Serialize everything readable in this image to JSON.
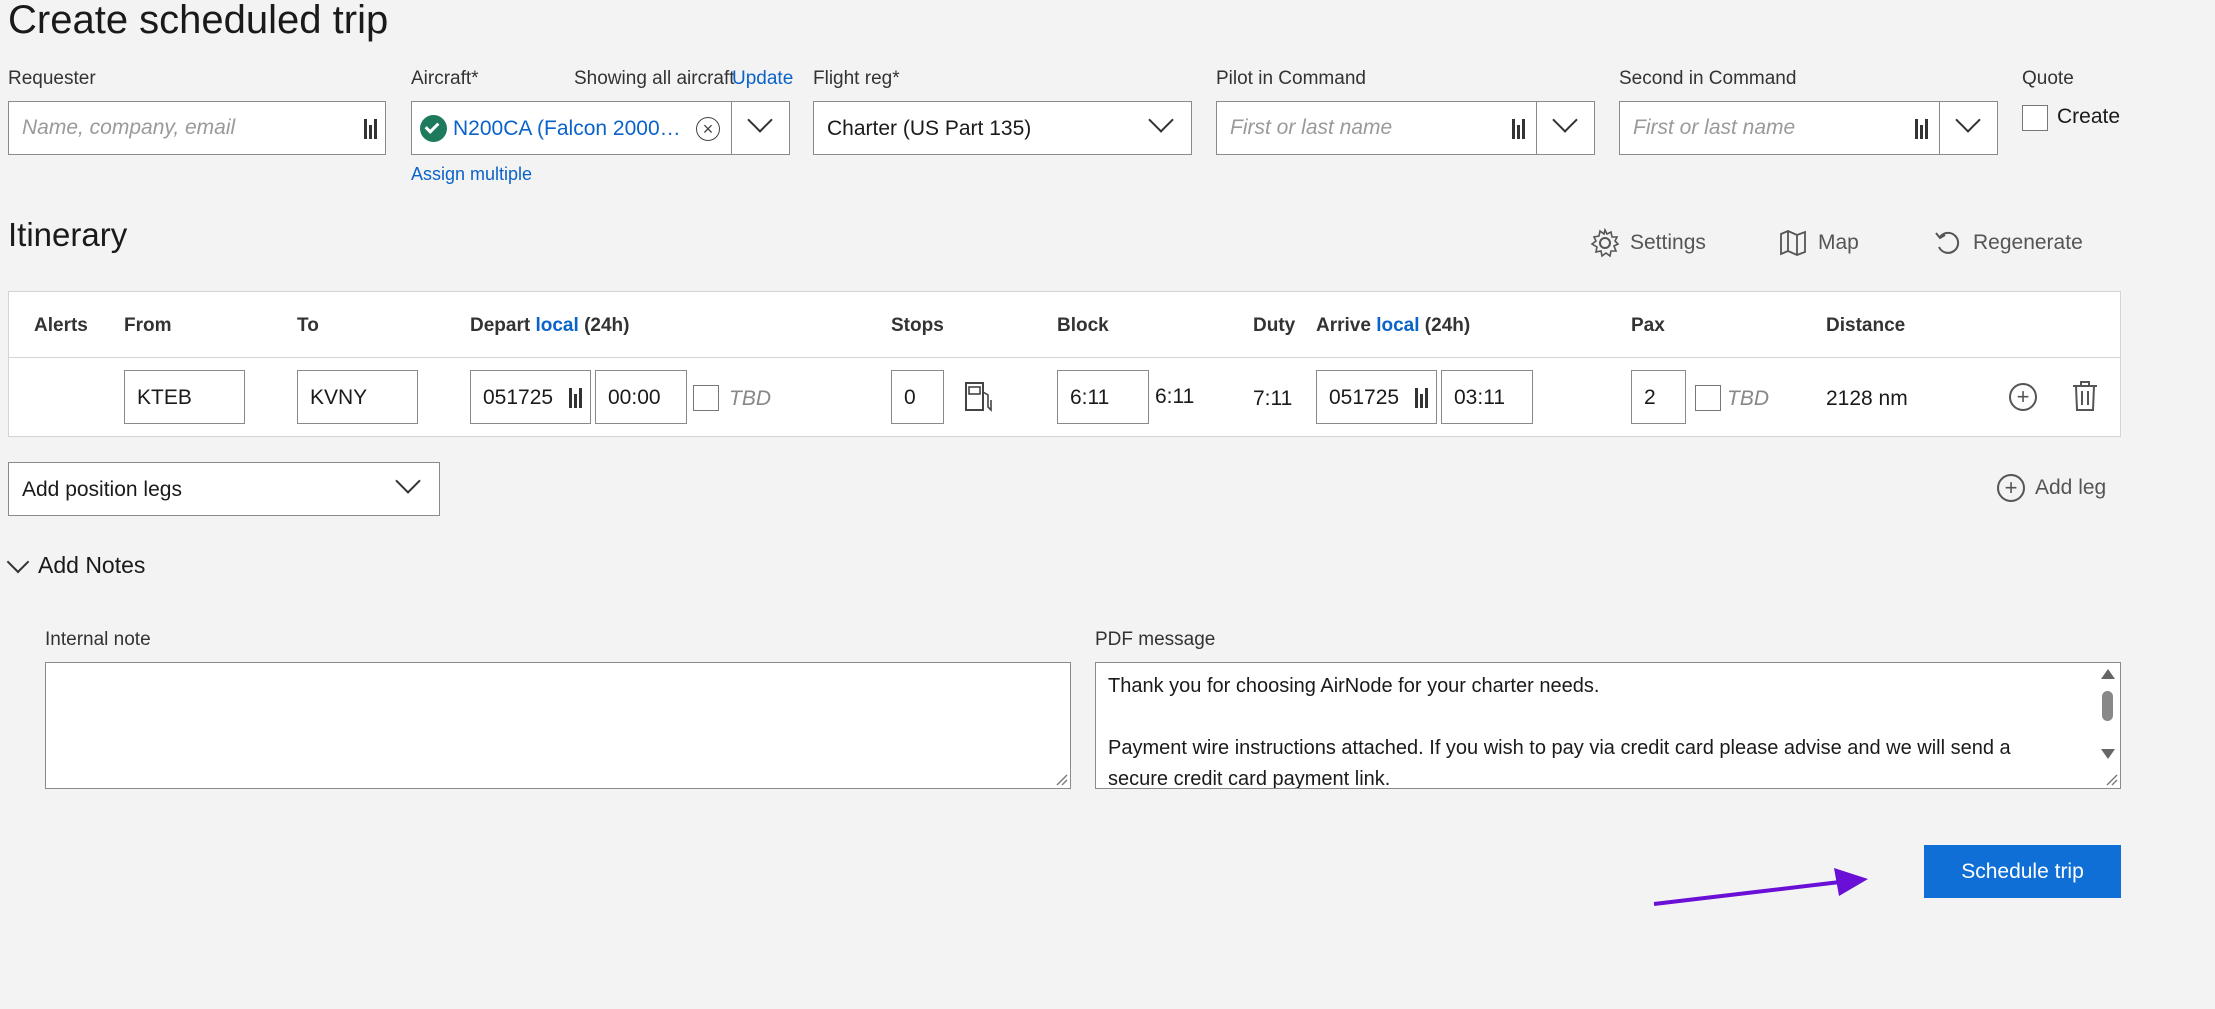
{
  "page": {
    "title": "Create scheduled trip"
  },
  "requester": {
    "label": "Requester",
    "placeholder": "Name, company, email"
  },
  "aircraft": {
    "label": "Aircraft*",
    "showing_text": "Showing all aircraft",
    "update_link": "Update",
    "value": "N200CA (Falcon 2000…",
    "assign_multiple": "Assign multiple"
  },
  "flight_reg": {
    "label": "Flight reg*",
    "value": "Charter (US Part 135)"
  },
  "pic": {
    "label": "Pilot in Command",
    "placeholder": "First or last name"
  },
  "sic": {
    "label": "Second in Command",
    "placeholder": "First or last name"
  },
  "quote": {
    "label": "Quote",
    "checkbox_label": "Create"
  },
  "itinerary": {
    "title": "Itinerary",
    "toolbar": {
      "settings": "Settings",
      "map": "Map",
      "regenerate": "Regenerate"
    },
    "headers": {
      "alerts": "Alerts",
      "from": "From",
      "to": "To",
      "depart": "Depart",
      "depart_local": "local",
      "depart_suffix": "(24h)",
      "stops": "Stops",
      "block": "Block",
      "duty": "Duty",
      "arrive": "Arrive",
      "arrive_local": "local",
      "arrive_suffix": "(24h)",
      "pax": "Pax",
      "distance": "Distance"
    },
    "row": {
      "from": "KTEB",
      "to": "KVNY",
      "depart_date": "051725",
      "depart_time": "00:00",
      "depart_tbd": "TBD",
      "stops": "0",
      "block_input": "6:11",
      "block_text": "6:11",
      "duty": "7:11",
      "arrive_date": "051725",
      "arrive_time": "03:11",
      "pax": "2",
      "pax_tbd": "TBD",
      "distance": "2128 nm"
    }
  },
  "position_legs": {
    "value": "Add position legs"
  },
  "add_leg": "Add leg",
  "notes": {
    "toggle": "Add Notes",
    "internal_label": "Internal note",
    "internal_value": "",
    "pdf_label": "PDF message",
    "pdf_line1": "Thank you for choosing AirNode for your charter needs.",
    "pdf_line2": "Payment wire instructions attached. If you wish to pay via credit card please advise and we will send a",
    "pdf_line3": "secure credit card payment link."
  },
  "actions": {
    "schedule": "Schedule trip"
  },
  "colors": {
    "accent": "#0f6fd6",
    "arrow": "#6a0fd6",
    "check": "#1e7a5c"
  }
}
